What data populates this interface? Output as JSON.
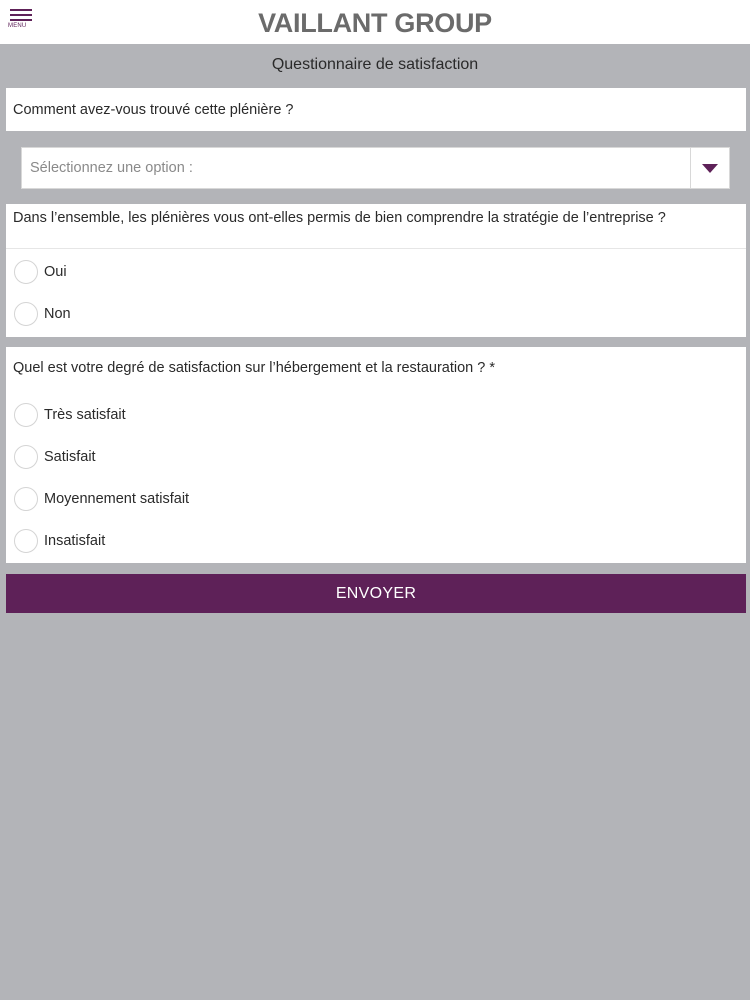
{
  "header": {
    "menu_label": "MENU",
    "brand": "VAILLANT GROUP"
  },
  "page": {
    "title": "Questionnaire de satisfaction"
  },
  "questions": [
    {
      "text": "Comment avez-vous trouvé cette plénière ?",
      "type": "select",
      "placeholder": "Sélectionnez une option :"
    },
    {
      "text": "Dans l’ensemble, les plénières vous ont-elles permis de bien comprendre la stratégie de l’entreprise ?",
      "type": "radio",
      "options": [
        "Oui",
        "Non"
      ]
    },
    {
      "text": "Quel est votre degré de satisfaction sur l’hébergement et la restauration ? *",
      "type": "radio",
      "options": [
        "Très satisfait",
        "Satisfait",
        "Moyennement satisfait",
        "Insatisfait"
      ]
    }
  ],
  "actions": {
    "submit_label": "ENVOYER"
  },
  "colors": {
    "accent": "#5e2158",
    "background": "#b3b4b8",
    "brand_text": "#6b6b6b"
  },
  "icons": {
    "menu": "hamburger-menu-icon",
    "dropdown": "triangle-down-icon",
    "radio": "radio-unchecked"
  }
}
